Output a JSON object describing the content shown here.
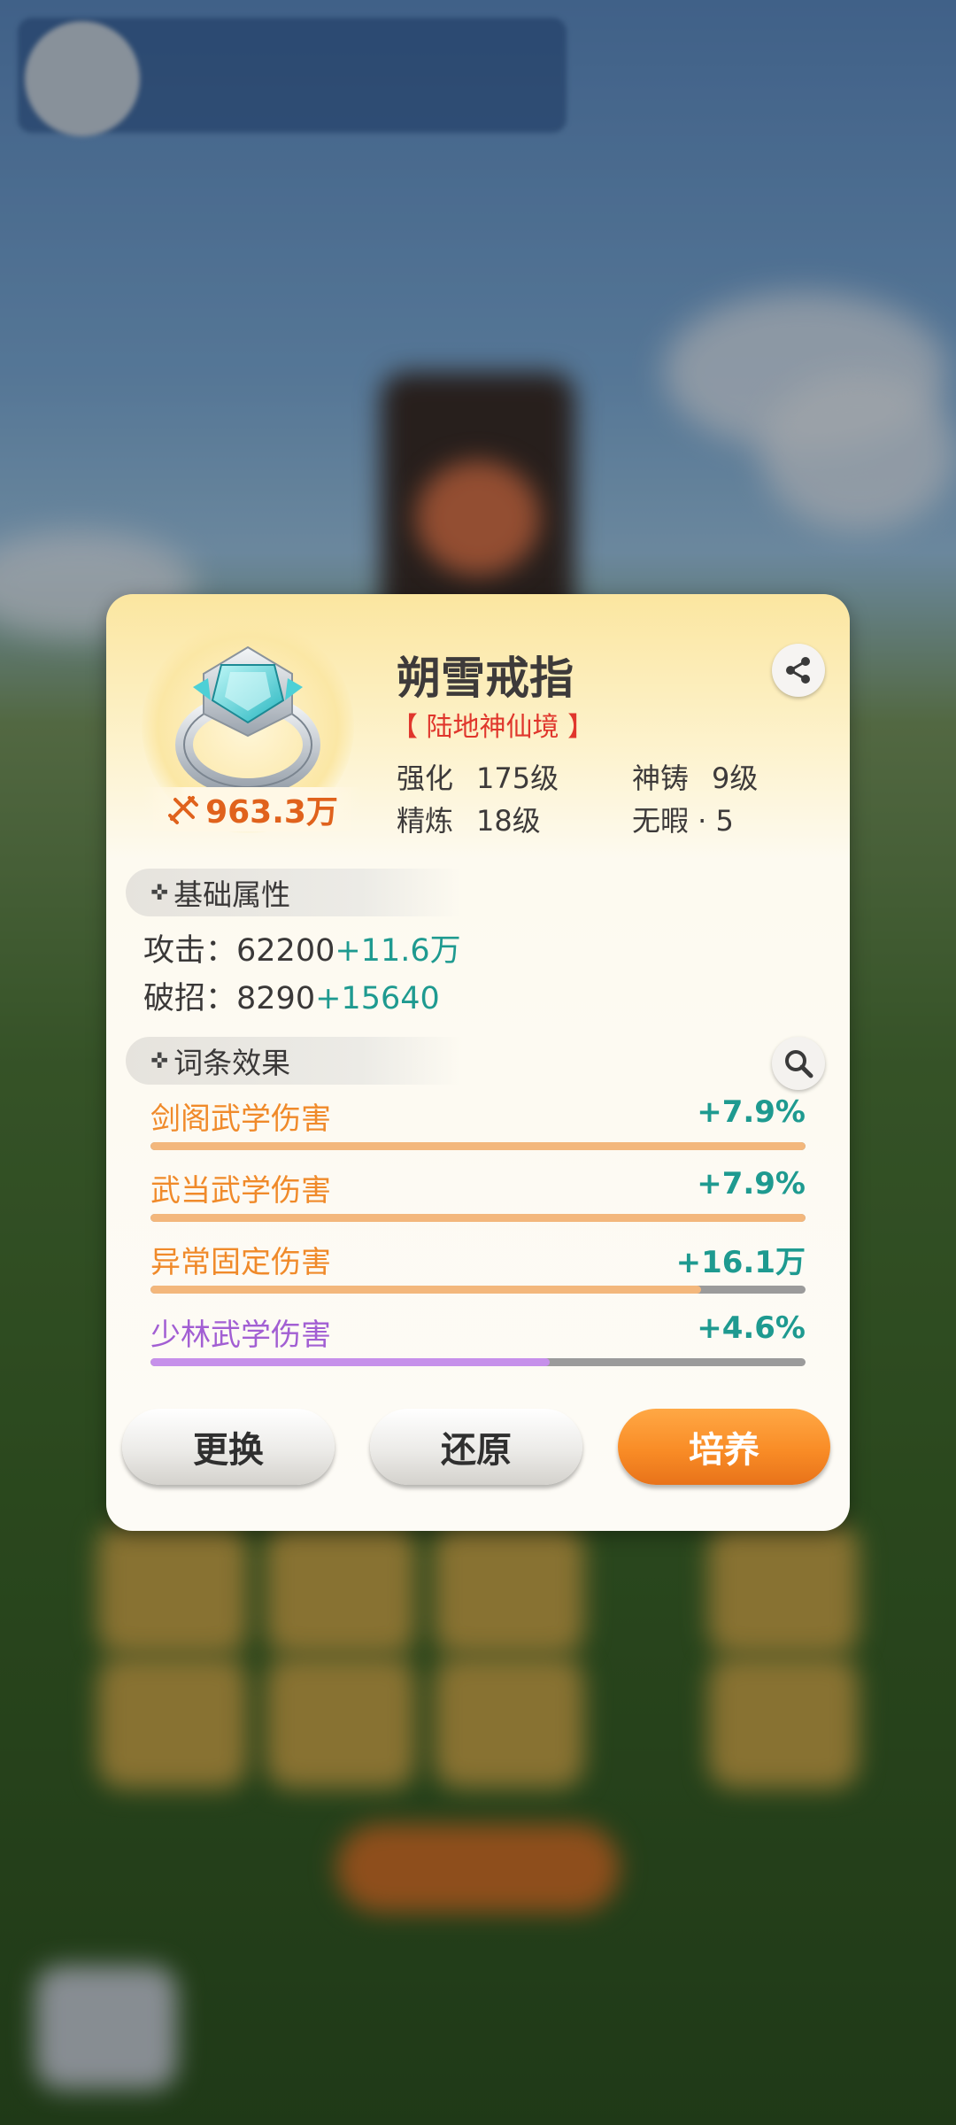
{
  "item": {
    "name": "朔雪戒指",
    "realm": "【 陆地神仙境 】",
    "power": "963.3万"
  },
  "stats": {
    "enhance_label": "强化",
    "enhance_value": "175级",
    "cast_label": "神铸",
    "cast_value": "9级",
    "refine_label": "精炼",
    "refine_value": "18级",
    "flawless_label": "无暇 · 5"
  },
  "base": {
    "title": "基础属性",
    "attrs": [
      {
        "label": "攻击：",
        "value": "62200",
        "bonus": "+11.6万"
      },
      {
        "label": "破招：",
        "value": "8290",
        "bonus": "+15640"
      }
    ]
  },
  "affixes": {
    "title": "词条效果",
    "items": [
      {
        "name": "剑阁武学伤害",
        "value": "+7.9%",
        "fill": 1.0,
        "color": "#f08a2a",
        "bar": "#f3b77c"
      },
      {
        "name": "武当武学伤害",
        "value": "+7.9%",
        "fill": 1.0,
        "color": "#f08a2a",
        "bar": "#f3b77c"
      },
      {
        "name": "异常固定伤害",
        "value": "+16.1万",
        "fill": 0.84,
        "color": "#f08a2a",
        "bar": "#f3b77c"
      },
      {
        "name": "少林武学伤害",
        "value": "+4.6%",
        "fill": 0.61,
        "color": "#a25fd3",
        "bar": "#c690ea"
      }
    ]
  },
  "buttons": {
    "replace": "更换",
    "restore": "还原",
    "cultivate": "培养"
  },
  "icons": [
    "share-icon",
    "search-icon",
    "power-icon",
    "ring-item-icon"
  ]
}
